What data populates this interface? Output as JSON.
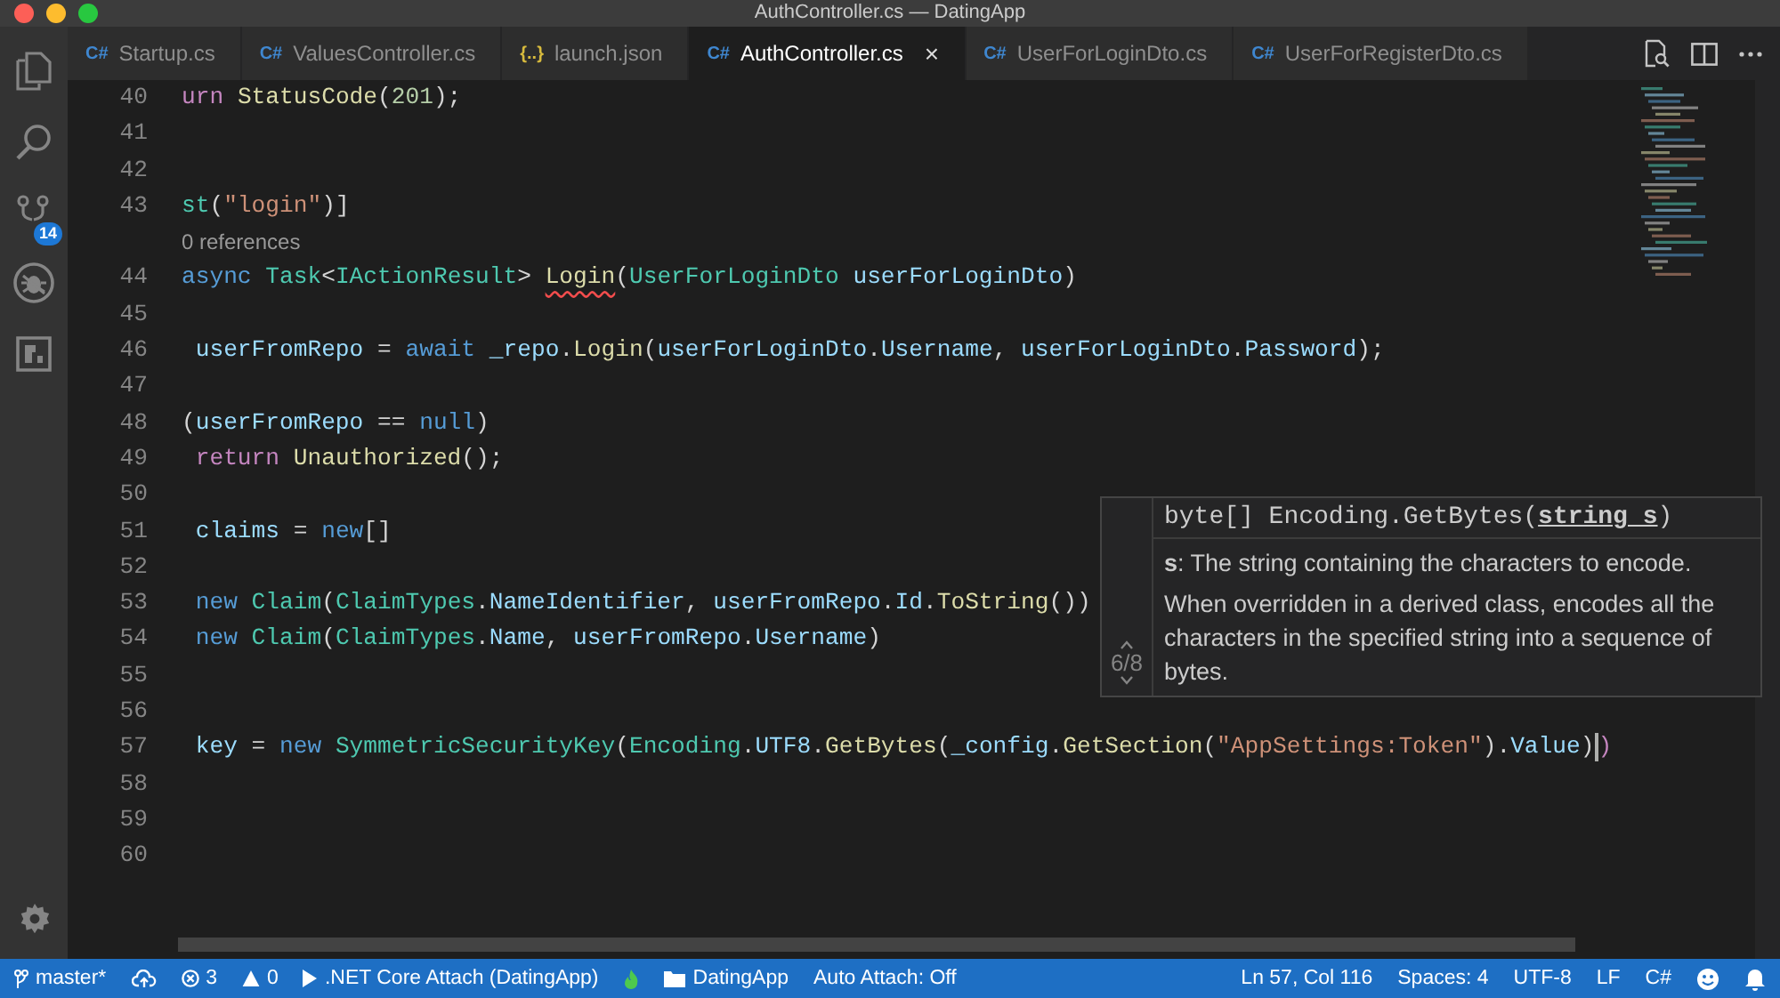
{
  "window": {
    "title": "AuthController.cs — DatingApp"
  },
  "activity_bar": {
    "items": [
      {
        "kind": "files"
      },
      {
        "kind": "search"
      },
      {
        "kind": "scm",
        "badge": "14"
      },
      {
        "kind": "debug"
      },
      {
        "kind": "extensions"
      }
    ]
  },
  "tabs": [
    {
      "label": "Startup.cs",
      "icon": "C#",
      "kind": "csharp",
      "selected": false
    },
    {
      "label": "ValuesController.cs",
      "icon": "C#",
      "kind": "csharp",
      "selected": false
    },
    {
      "label": "launch.json",
      "icon": "{..}",
      "kind": "json",
      "selected": false
    },
    {
      "label": "AuthController.cs",
      "icon": "C#",
      "kind": "csharp",
      "selected": true,
      "close": "×"
    },
    {
      "label": "UserForLoginDto.cs",
      "icon": "C#",
      "kind": "csharp",
      "selected": false
    },
    {
      "label": "UserForRegisterDto.cs",
      "icon": "C#",
      "kind": "csharp",
      "selected": false
    }
  ],
  "editor": {
    "lines": [
      {
        "kind": "code",
        "number": "40",
        "tokens": [
          {
            "t": "urn ",
            "color": "#c586c0"
          },
          {
            "t": "StatusCode",
            "color": "#dcdcaa"
          },
          {
            "t": "(",
            "color": "#d4d4d4"
          },
          {
            "t": "201",
            "color": "#b5cea8"
          },
          {
            "t": ");",
            "color": "#d4d4d4"
          }
        ]
      },
      {
        "kind": "code",
        "number": "41"
      },
      {
        "kind": "code",
        "number": "42"
      },
      {
        "kind": "code",
        "number": "43",
        "tokens": [
          {
            "t": "st",
            "color": "#4ec9b0"
          },
          {
            "t": "(",
            "color": "#d4d4d4"
          },
          {
            "t": "\"login\"",
            "color": "#ce9178"
          },
          {
            "t": ")]",
            "color": "#d4d4d4"
          }
        ]
      },
      {
        "kind": "codelens",
        "text": "0 references"
      },
      {
        "kind": "code",
        "number": "44",
        "tokens": [
          {
            "t": "async ",
            "color": "#569cd6"
          },
          {
            "t": "Task",
            "color": "#4ec9b0"
          },
          {
            "t": "<",
            "color": "#d4d4d4"
          },
          {
            "t": "IActionResult",
            "color": "#4ec9b0"
          },
          {
            "t": "> ",
            "color": "#d4d4d4"
          },
          {
            "t": "Login",
            "color": "#dcdcaa",
            "error": true
          },
          {
            "t": "(",
            "color": "#d4d4d4"
          },
          {
            "t": "UserForLoginDto ",
            "color": "#4ec9b0"
          },
          {
            "t": "userForLoginDto",
            "color": "#9cdcfe"
          },
          {
            "t": ")",
            "color": "#d4d4d4"
          }
        ]
      },
      {
        "kind": "code",
        "number": "45"
      },
      {
        "kind": "code",
        "number": "46",
        "tokens": [
          {
            "t": " userFromRepo",
            "color": "#9cdcfe"
          },
          {
            "t": " = ",
            "color": "#d4d4d4"
          },
          {
            "t": "await ",
            "color": "#569cd6"
          },
          {
            "t": "_repo",
            "color": "#9cdcfe"
          },
          {
            "t": ".",
            "color": "#d4d4d4"
          },
          {
            "t": "Login",
            "color": "#dcdcaa"
          },
          {
            "t": "(",
            "color": "#d4d4d4"
          },
          {
            "t": "userForLoginDto",
            "color": "#9cdcfe"
          },
          {
            "t": ".",
            "color": "#d4d4d4"
          },
          {
            "t": "Username",
            "color": "#9cdcfe"
          },
          {
            "t": ", ",
            "color": "#d4d4d4"
          },
          {
            "t": "userForLoginDto",
            "color": "#9cdcfe"
          },
          {
            "t": ".",
            "color": "#d4d4d4"
          },
          {
            "t": "Password",
            "color": "#9cdcfe"
          },
          {
            "t": ");",
            "color": "#d4d4d4"
          }
        ]
      },
      {
        "kind": "code",
        "number": "47"
      },
      {
        "kind": "code",
        "number": "48",
        "tokens": [
          {
            "t": "(",
            "color": "#d4d4d4"
          },
          {
            "t": "userFromRepo",
            "color": "#9cdcfe"
          },
          {
            "t": " == ",
            "color": "#d4d4d4"
          },
          {
            "t": "null",
            "color": "#569cd6"
          },
          {
            "t": ")",
            "color": "#d4d4d4"
          }
        ]
      },
      {
        "kind": "code",
        "number": "49",
        "tokens": [
          {
            "t": " return ",
            "color": "#c586c0"
          },
          {
            "t": "Unauthorized",
            "color": "#dcdcaa"
          },
          {
            "t": "();",
            "color": "#d4d4d4"
          }
        ]
      },
      {
        "kind": "code",
        "number": "50"
      },
      {
        "kind": "code",
        "number": "51",
        "tokens": [
          {
            "t": " claims",
            "color": "#9cdcfe"
          },
          {
            "t": " = ",
            "color": "#d4d4d4"
          },
          {
            "t": "new",
            "color": "#569cd6"
          },
          {
            "t": "[]",
            "color": "#d4d4d4"
          }
        ]
      },
      {
        "kind": "code",
        "number": "52"
      },
      {
        "kind": "code",
        "number": "53",
        "tokens": [
          {
            "t": " new ",
            "color": "#569cd6"
          },
          {
            "t": "Claim",
            "color": "#4ec9b0"
          },
          {
            "t": "(",
            "color": "#d4d4d4"
          },
          {
            "t": "ClaimTypes",
            "color": "#4ec9b0"
          },
          {
            "t": ".",
            "color": "#d4d4d4"
          },
          {
            "t": "NameIdentifier",
            "color": "#9cdcfe"
          },
          {
            "t": ", ",
            "color": "#d4d4d4"
          },
          {
            "t": "userFromRepo",
            "color": "#9cdcfe"
          },
          {
            "t": ".",
            "color": "#d4d4d4"
          },
          {
            "t": "Id",
            "color": "#9cdcfe"
          },
          {
            "t": ".",
            "color": "#d4d4d4"
          },
          {
            "t": "ToString",
            "color": "#dcdcaa"
          },
          {
            "t": "())",
            "color": "#d4d4d4"
          }
        ]
      },
      {
        "kind": "code",
        "number": "54",
        "tokens": [
          {
            "t": " new ",
            "color": "#569cd6"
          },
          {
            "t": "Claim",
            "color": "#4ec9b0"
          },
          {
            "t": "(",
            "color": "#d4d4d4"
          },
          {
            "t": "ClaimTypes",
            "color": "#4ec9b0"
          },
          {
            "t": ".",
            "color": "#d4d4d4"
          },
          {
            "t": "Name",
            "color": "#9cdcfe"
          },
          {
            "t": ", ",
            "color": "#d4d4d4"
          },
          {
            "t": "userFromRepo",
            "color": "#9cdcfe"
          },
          {
            "t": ".",
            "color": "#d4d4d4"
          },
          {
            "t": "Username",
            "color": "#9cdcfe"
          },
          {
            "t": ")",
            "color": "#d4d4d4"
          }
        ]
      },
      {
        "kind": "code",
        "number": "55"
      },
      {
        "kind": "code",
        "number": "56"
      },
      {
        "kind": "code",
        "number": "57",
        "tokens": [
          {
            "t": " key",
            "color": "#9cdcfe"
          },
          {
            "t": " = ",
            "color": "#d4d4d4"
          },
          {
            "t": "new ",
            "color": "#569cd6"
          },
          {
            "t": "SymmetricSecurityKey",
            "color": "#4ec9b0"
          },
          {
            "t": "(",
            "color": "#d4d4d4"
          },
          {
            "t": "Encoding",
            "color": "#4ec9b0"
          },
          {
            "t": ".",
            "color": "#d4d4d4"
          },
          {
            "t": "UTF8",
            "color": "#9cdcfe"
          },
          {
            "t": ".",
            "color": "#d4d4d4"
          },
          {
            "t": "GetBytes",
            "color": "#dcdcaa"
          },
          {
            "t": "(",
            "color": "#d4d4d4"
          },
          {
            "t": "_config",
            "color": "#9cdcfe"
          },
          {
            "t": ".",
            "color": "#d4d4d4"
          },
          {
            "t": "GetSection",
            "color": "#dcdcaa"
          },
          {
            "t": "(",
            "color": "#d4d4d4"
          },
          {
            "t": "\"AppSettings:Token\"",
            "color": "#ce9178"
          },
          {
            "t": ").",
            "color": "#d4d4d4"
          },
          {
            "t": "Value",
            "color": "#9cdcfe"
          },
          {
            "t": ")",
            "color": "#d4d4d4",
            "cursor": true
          },
          {
            "t": ")",
            "color": "#c586c0"
          }
        ]
      },
      {
        "kind": "code",
        "number": "58"
      },
      {
        "kind": "code",
        "number": "59"
      },
      {
        "kind": "code",
        "number": "60"
      }
    ],
    "hover": {
      "signature": "byte[] Encoding.GetBytes(**string s**)",
      "param": "**s**: The string containing the characters to encode.",
      "description": "When overridden in a derived class, encodes all the characters in the specified string into a sequence of bytes.",
      "counter": "6/8"
    }
  },
  "status_bar": {
    "left": [
      {
        "kind": "branch",
        "text": "master*"
      },
      {
        "kind": "sync"
      },
      {
        "kind": "errors",
        "text": "3"
      },
      {
        "kind": "warnings",
        "text": "0"
      },
      {
        "kind": "debug",
        "text": ".NET Core Attach (DatingApp)"
      },
      {
        "kind": "flame"
      },
      {
        "kind": "folder",
        "text": "DatingApp"
      },
      {
        "kind": "text",
        "text": "Auto Attach: Off"
      }
    ],
    "right": [
      {
        "kind": "text",
        "text": "Ln 57, Col 116"
      },
      {
        "kind": "text",
        "text": "Spaces: 4"
      },
      {
        "kind": "text",
        "text": "UTF-8"
      },
      {
        "kind": "text",
        "text": "LF"
      },
      {
        "kind": "text",
        "text": "C#"
      },
      {
        "kind": "smiley"
      },
      {
        "kind": "bell"
      }
    ]
  }
}
